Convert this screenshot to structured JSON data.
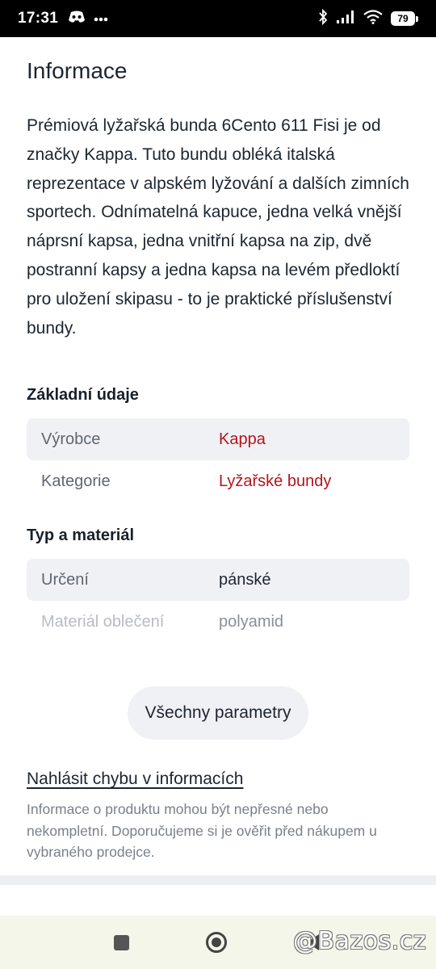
{
  "status_bar": {
    "time": "17:31",
    "battery_level": "79",
    "icons": [
      "discord-icon",
      "more-dots-icon",
      "bluetooth-icon",
      "signal-icon",
      "wifi-icon",
      "battery-icon"
    ]
  },
  "info": {
    "title": "Informace",
    "description": "Prémiová lyžařská bunda 6Cento 611 Fisi je od značky Kappa. Tuto bundu obléká italská reprezentace v alpském lyžování a dalších zimních sportech. Odnímatelná kapuce, jedna velká vnější náprsní kapsa, jedna vnitřní kapsa na zip, dvě postranní kapsy a jedna kapsa na levém předloktí pro uložení skipasu - to je praktické příslušenství bundy."
  },
  "basic": {
    "title": "Základní údaje",
    "rows": [
      {
        "key": "Výrobce",
        "value": "Kappa"
      },
      {
        "key": "Kategorie",
        "value": "Lyžařské bundy"
      }
    ]
  },
  "material": {
    "title": "Typ a materiál",
    "rows": [
      {
        "key": "Určení",
        "value": "pánské"
      },
      {
        "key": "Materiál oblečení",
        "value": "polyamid"
      }
    ]
  },
  "all_params_label": "Všechny parametry",
  "report_link": "Nahlásit chybu v informacích",
  "disclaimer": "Informace o produktu mohou být nepřesné nebo nekompletní. Doporučujeme si je ověřit před nákupem u vybraného prodejce.",
  "watermark": "@Bazos.cz",
  "colors": {
    "link_red": "#b3161b",
    "row_shade": "#f0f1f4",
    "nav_bg": "#f4f6ea"
  }
}
